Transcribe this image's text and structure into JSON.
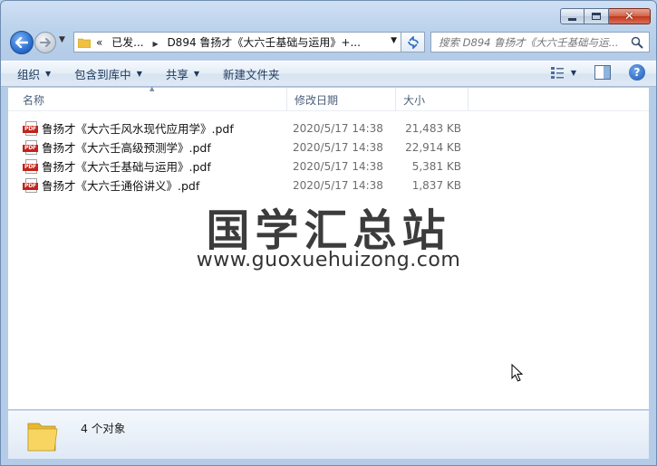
{
  "window": {
    "min_icon": "minimize-icon",
    "max_icon": "maximize-icon",
    "close_icon": "close-icon"
  },
  "nav": {
    "address": {
      "prefix": "«",
      "crumb1": "已发...",
      "separator": "▶",
      "crumb2": "D894 鲁扬才《大六壬基础与运用》+..."
    },
    "search": {
      "placeholder": "搜索 D894 鲁扬才《大六壬基础与运..."
    }
  },
  "toolbar": {
    "organize": "组织",
    "include_in_library": "包含到库中",
    "share": "共享",
    "new_folder": "新建文件夹",
    "help": "?"
  },
  "columns": {
    "name": "名称",
    "date": "修改日期",
    "size": "大小"
  },
  "files": [
    {
      "name": "鲁扬才《大六壬风水现代应用学》.pdf",
      "date": "2020/5/17 14:38",
      "size": "21,483 KB"
    },
    {
      "name": "鲁扬才《大六壬高级预测学》.pdf",
      "date": "2020/5/17 14:38",
      "size": "22,914 KB"
    },
    {
      "name": "鲁扬才《大六壬基础与运用》.pdf",
      "date": "2020/5/17 14:38",
      "size": "5,381 KB"
    },
    {
      "name": "鲁扬才《大六壬通俗讲义》.pdf",
      "date": "2020/5/17 14:38",
      "size": "1,837 KB"
    }
  ],
  "file_icon_label": "PDF",
  "watermark": {
    "title": "国学汇总站",
    "url": "www.guoxuehuizong.com"
  },
  "details": {
    "count": "4 个对象"
  },
  "colors": {
    "accent": "#2c6fd1",
    "pdf_red": "#c2241b",
    "folder_yellow": "#f0c040"
  }
}
